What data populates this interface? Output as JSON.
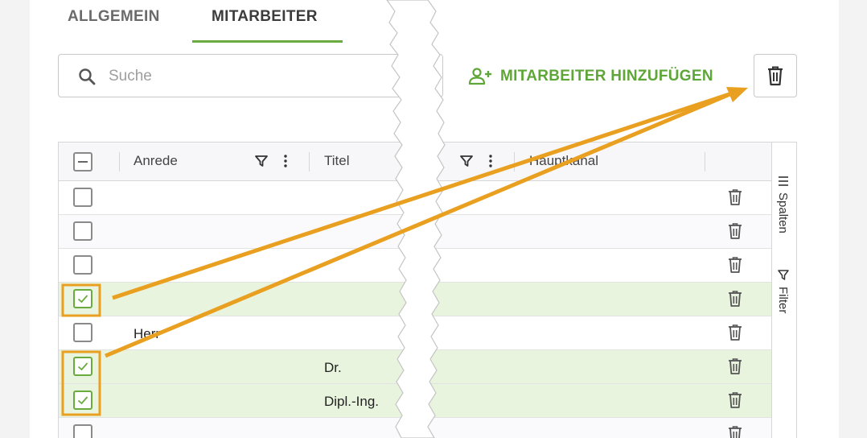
{
  "tabs": [
    {
      "label": "ALLGEMEIN",
      "active": false
    },
    {
      "label": "MITARBEITER",
      "active": true
    }
  ],
  "search": {
    "placeholder": "Suche",
    "value": ""
  },
  "toolbar": {
    "add_label": "MITARBEITER HINZUFÜGEN"
  },
  "grid": {
    "columns": {
      "anrede": "Anrede",
      "titel": "Titel",
      "hauptkanal": "Hauptkanal"
    },
    "rows": [
      {
        "checked": false,
        "anrede": "",
        "titel": ""
      },
      {
        "checked": false,
        "anrede": "",
        "titel": ""
      },
      {
        "checked": false,
        "anrede": "",
        "titel": ""
      },
      {
        "checked": true,
        "anrede": "",
        "titel": ""
      },
      {
        "checked": false,
        "anrede": "Herr",
        "titel": ""
      },
      {
        "checked": true,
        "anrede": "",
        "titel": "Dr."
      },
      {
        "checked": true,
        "anrede": "",
        "titel": "Dipl.-Ing."
      },
      {
        "checked": false,
        "anrede": "",
        "titel": ""
      }
    ]
  },
  "side_panel": {
    "columns_label": "Spalten",
    "filter_label": "Filter"
  },
  "colors": {
    "accent": "#6aab3f",
    "annotation": "#e9a020",
    "selected_row": "#e9f4df"
  }
}
